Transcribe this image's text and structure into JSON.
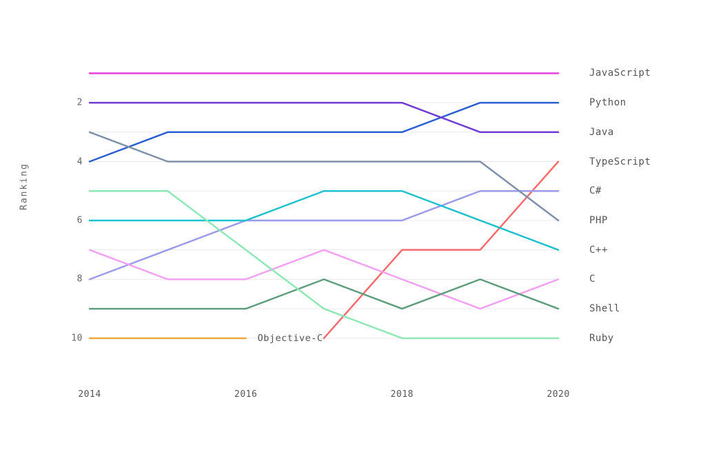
{
  "chart_data": {
    "type": "line",
    "ylabel": "Ranking",
    "ylim": [
      10.8,
      0.5
    ],
    "x": [
      2014,
      2015,
      2016,
      2017,
      2018,
      2019,
      2020
    ],
    "x_ticks": [
      2014,
      2016,
      2018,
      2020
    ],
    "y_ticks": [
      2,
      4,
      6,
      8,
      10
    ],
    "series": [
      {
        "name": "JavaScript",
        "color": "#e83fdb",
        "values": [
          1,
          1,
          1,
          1,
          1,
          1,
          1
        ],
        "end_label": "JavaScript",
        "end_rank": 1
      },
      {
        "name": "Python",
        "color": "#2b5fd1",
        "values": [
          4,
          3,
          3,
          3,
          3,
          2,
          2
        ],
        "end_label": "Python",
        "end_rank": 2
      },
      {
        "name": "Java",
        "color": "#6f3bd5",
        "values": [
          2,
          2,
          2,
          2,
          2,
          3,
          3
        ],
        "end_label": "Java",
        "end_rank": 3
      },
      {
        "name": "TypeScript",
        "color": "#f86a6a",
        "values": [
          null,
          null,
          null,
          10,
          7,
          7,
          4
        ],
        "end_label": "TypeScript",
        "end_rank": 4
      },
      {
        "name": "C#",
        "color": "#9b9bea",
        "values": [
          8,
          7,
          6,
          6,
          6,
          5,
          5
        ],
        "end_label": "C#",
        "end_rank": 5
      },
      {
        "name": "PHP",
        "color": "#7f90a8",
        "values": [
          3,
          4,
          4,
          4,
          4,
          4,
          6
        ],
        "end_label": "PHP",
        "end_rank": 6
      },
      {
        "name": "C++",
        "color": "#1fc1cf",
        "values": [
          6,
          6,
          6,
          5,
          5,
          6,
          7
        ],
        "end_label": "C++",
        "end_rank": 7
      },
      {
        "name": "C",
        "color": "#f2a1f2",
        "values": [
          7,
          8,
          8,
          7,
          8,
          9,
          8
        ],
        "end_label": "C",
        "end_rank": 8
      },
      {
        "name": "Shell",
        "color": "#5e9e7e",
        "values": [
          9,
          9,
          9,
          8,
          9,
          8,
          9
        ],
        "end_label": "Shell",
        "end_rank": 9
      },
      {
        "name": "Ruby",
        "color": "#8ee8b6",
        "values": [
          5,
          5,
          7,
          9,
          10,
          10,
          10
        ],
        "end_label": "Ruby",
        "end_rank": 10
      },
      {
        "name": "Objective-C",
        "color": "#f0a63e",
        "values": [
          10,
          10,
          10,
          null,
          null,
          null,
          null
        ],
        "mid_label": "Objective-C",
        "mid_x": 2016.15,
        "mid_rank": 10
      }
    ]
  }
}
